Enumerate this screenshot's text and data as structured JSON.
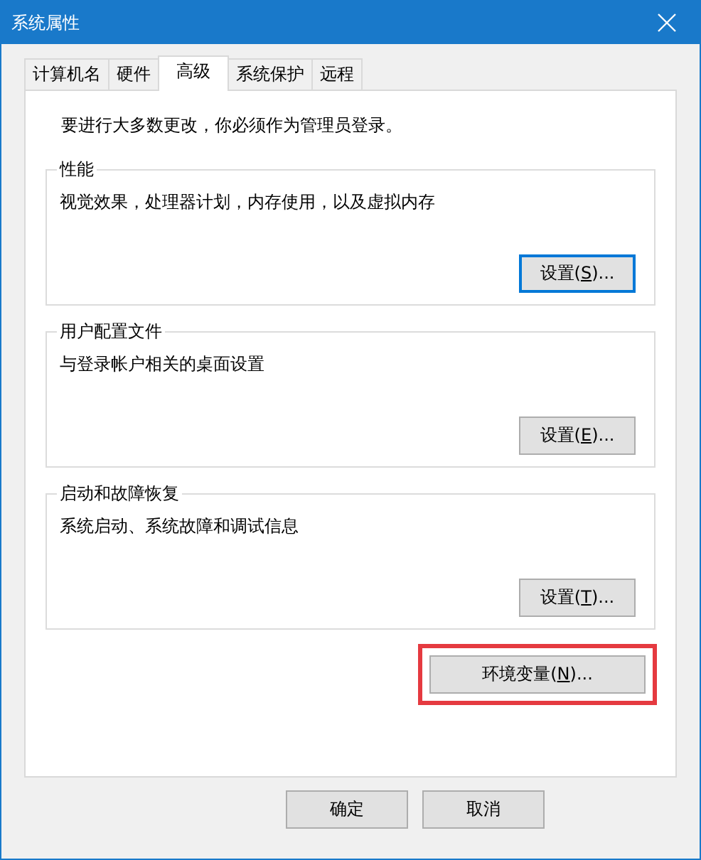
{
  "window": {
    "title": "系统属性"
  },
  "tabs": [
    {
      "label": "计算机名",
      "selected": false
    },
    {
      "label": "硬件",
      "selected": false
    },
    {
      "label": "高级",
      "selected": true
    },
    {
      "label": "系统保护",
      "selected": false
    },
    {
      "label": "远程",
      "selected": false
    }
  ],
  "notice": "要进行大多数更改，你必须作为管理员登录。",
  "groups": [
    {
      "title": "性能",
      "description": "视觉效果，处理器计划，内存使用，以及虚拟内存",
      "button": {
        "label_before": "设置(",
        "access_key": "S",
        "label_after": ")...",
        "focused": true
      }
    },
    {
      "title": "用户配置文件",
      "description": "与登录帐户相关的桌面设置",
      "button": {
        "label_before": "设置(",
        "access_key": "E",
        "label_after": ")...",
        "focused": false
      }
    },
    {
      "title": "启动和故障恢复",
      "description": "系统启动、系统故障和调试信息",
      "button": {
        "label_before": "设置(",
        "access_key": "T",
        "label_after": ")...",
        "focused": false
      }
    }
  ],
  "env_button": {
    "label_before": "环境变量(",
    "access_key": "N",
    "label_after": ")...",
    "highlighted": true
  },
  "buttons": [
    {
      "label": "确定"
    },
    {
      "label": "取消"
    }
  ]
}
